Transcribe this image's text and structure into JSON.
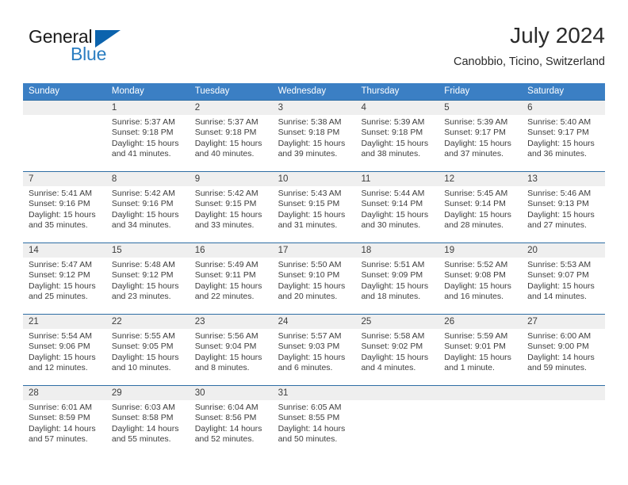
{
  "brand": {
    "name_top": "General",
    "name_bottom": "Blue",
    "accent_color": "#0c63ad",
    "blue_text_color": "#2a7dc1"
  },
  "header": {
    "title": "July 2024",
    "subtitle": "Canobbio, Ticino, Switzerland"
  },
  "theme": {
    "header_row_bg": "#3b7fc4",
    "date_band_bg": "#efefef",
    "row_divider": "#2e6da4",
    "text_color": "#3d3d3d"
  },
  "weekdays": [
    "Sunday",
    "Monday",
    "Tuesday",
    "Wednesday",
    "Thursday",
    "Friday",
    "Saturday"
  ],
  "weeks": [
    {
      "days": [
        {
          "num": "",
          "sunrise": "",
          "sunset": "",
          "daylight_1": "",
          "daylight_2": ""
        },
        {
          "num": "1",
          "sunrise": "Sunrise: 5:37 AM",
          "sunset": "Sunset: 9:18 PM",
          "daylight_1": "Daylight: 15 hours",
          "daylight_2": "and 41 minutes."
        },
        {
          "num": "2",
          "sunrise": "Sunrise: 5:37 AM",
          "sunset": "Sunset: 9:18 PM",
          "daylight_1": "Daylight: 15 hours",
          "daylight_2": "and 40 minutes."
        },
        {
          "num": "3",
          "sunrise": "Sunrise: 5:38 AM",
          "sunset": "Sunset: 9:18 PM",
          "daylight_1": "Daylight: 15 hours",
          "daylight_2": "and 39 minutes."
        },
        {
          "num": "4",
          "sunrise": "Sunrise: 5:39 AM",
          "sunset": "Sunset: 9:18 PM",
          "daylight_1": "Daylight: 15 hours",
          "daylight_2": "and 38 minutes."
        },
        {
          "num": "5",
          "sunrise": "Sunrise: 5:39 AM",
          "sunset": "Sunset: 9:17 PM",
          "daylight_1": "Daylight: 15 hours",
          "daylight_2": "and 37 minutes."
        },
        {
          "num": "6",
          "sunrise": "Sunrise: 5:40 AM",
          "sunset": "Sunset: 9:17 PM",
          "daylight_1": "Daylight: 15 hours",
          "daylight_2": "and 36 minutes."
        }
      ]
    },
    {
      "days": [
        {
          "num": "7",
          "sunrise": "Sunrise: 5:41 AM",
          "sunset": "Sunset: 9:16 PM",
          "daylight_1": "Daylight: 15 hours",
          "daylight_2": "and 35 minutes."
        },
        {
          "num": "8",
          "sunrise": "Sunrise: 5:42 AM",
          "sunset": "Sunset: 9:16 PM",
          "daylight_1": "Daylight: 15 hours",
          "daylight_2": "and 34 minutes."
        },
        {
          "num": "9",
          "sunrise": "Sunrise: 5:42 AM",
          "sunset": "Sunset: 9:15 PM",
          "daylight_1": "Daylight: 15 hours",
          "daylight_2": "and 33 minutes."
        },
        {
          "num": "10",
          "sunrise": "Sunrise: 5:43 AM",
          "sunset": "Sunset: 9:15 PM",
          "daylight_1": "Daylight: 15 hours",
          "daylight_2": "and 31 minutes."
        },
        {
          "num": "11",
          "sunrise": "Sunrise: 5:44 AM",
          "sunset": "Sunset: 9:14 PM",
          "daylight_1": "Daylight: 15 hours",
          "daylight_2": "and 30 minutes."
        },
        {
          "num": "12",
          "sunrise": "Sunrise: 5:45 AM",
          "sunset": "Sunset: 9:14 PM",
          "daylight_1": "Daylight: 15 hours",
          "daylight_2": "and 28 minutes."
        },
        {
          "num": "13",
          "sunrise": "Sunrise: 5:46 AM",
          "sunset": "Sunset: 9:13 PM",
          "daylight_1": "Daylight: 15 hours",
          "daylight_2": "and 27 minutes."
        }
      ]
    },
    {
      "days": [
        {
          "num": "14",
          "sunrise": "Sunrise: 5:47 AM",
          "sunset": "Sunset: 9:12 PM",
          "daylight_1": "Daylight: 15 hours",
          "daylight_2": "and 25 minutes."
        },
        {
          "num": "15",
          "sunrise": "Sunrise: 5:48 AM",
          "sunset": "Sunset: 9:12 PM",
          "daylight_1": "Daylight: 15 hours",
          "daylight_2": "and 23 minutes."
        },
        {
          "num": "16",
          "sunrise": "Sunrise: 5:49 AM",
          "sunset": "Sunset: 9:11 PM",
          "daylight_1": "Daylight: 15 hours",
          "daylight_2": "and 22 minutes."
        },
        {
          "num": "17",
          "sunrise": "Sunrise: 5:50 AM",
          "sunset": "Sunset: 9:10 PM",
          "daylight_1": "Daylight: 15 hours",
          "daylight_2": "and 20 minutes."
        },
        {
          "num": "18",
          "sunrise": "Sunrise: 5:51 AM",
          "sunset": "Sunset: 9:09 PM",
          "daylight_1": "Daylight: 15 hours",
          "daylight_2": "and 18 minutes."
        },
        {
          "num": "19",
          "sunrise": "Sunrise: 5:52 AM",
          "sunset": "Sunset: 9:08 PM",
          "daylight_1": "Daylight: 15 hours",
          "daylight_2": "and 16 minutes."
        },
        {
          "num": "20",
          "sunrise": "Sunrise: 5:53 AM",
          "sunset": "Sunset: 9:07 PM",
          "daylight_1": "Daylight: 15 hours",
          "daylight_2": "and 14 minutes."
        }
      ]
    },
    {
      "days": [
        {
          "num": "21",
          "sunrise": "Sunrise: 5:54 AM",
          "sunset": "Sunset: 9:06 PM",
          "daylight_1": "Daylight: 15 hours",
          "daylight_2": "and 12 minutes."
        },
        {
          "num": "22",
          "sunrise": "Sunrise: 5:55 AM",
          "sunset": "Sunset: 9:05 PM",
          "daylight_1": "Daylight: 15 hours",
          "daylight_2": "and 10 minutes."
        },
        {
          "num": "23",
          "sunrise": "Sunrise: 5:56 AM",
          "sunset": "Sunset: 9:04 PM",
          "daylight_1": "Daylight: 15 hours",
          "daylight_2": "and 8 minutes."
        },
        {
          "num": "24",
          "sunrise": "Sunrise: 5:57 AM",
          "sunset": "Sunset: 9:03 PM",
          "daylight_1": "Daylight: 15 hours",
          "daylight_2": "and 6 minutes."
        },
        {
          "num": "25",
          "sunrise": "Sunrise: 5:58 AM",
          "sunset": "Sunset: 9:02 PM",
          "daylight_1": "Daylight: 15 hours",
          "daylight_2": "and 4 minutes."
        },
        {
          "num": "26",
          "sunrise": "Sunrise: 5:59 AM",
          "sunset": "Sunset: 9:01 PM",
          "daylight_1": "Daylight: 15 hours",
          "daylight_2": "and 1 minute."
        },
        {
          "num": "27",
          "sunrise": "Sunrise: 6:00 AM",
          "sunset": "Sunset: 9:00 PM",
          "daylight_1": "Daylight: 14 hours",
          "daylight_2": "and 59 minutes."
        }
      ]
    },
    {
      "days": [
        {
          "num": "28",
          "sunrise": "Sunrise: 6:01 AM",
          "sunset": "Sunset: 8:59 PM",
          "daylight_1": "Daylight: 14 hours",
          "daylight_2": "and 57 minutes."
        },
        {
          "num": "29",
          "sunrise": "Sunrise: 6:03 AM",
          "sunset": "Sunset: 8:58 PM",
          "daylight_1": "Daylight: 14 hours",
          "daylight_2": "and 55 minutes."
        },
        {
          "num": "30",
          "sunrise": "Sunrise: 6:04 AM",
          "sunset": "Sunset: 8:56 PM",
          "daylight_1": "Daylight: 14 hours",
          "daylight_2": "and 52 minutes."
        },
        {
          "num": "31",
          "sunrise": "Sunrise: 6:05 AM",
          "sunset": "Sunset: 8:55 PM",
          "daylight_1": "Daylight: 14 hours",
          "daylight_2": "and 50 minutes."
        },
        {
          "num": "",
          "sunrise": "",
          "sunset": "",
          "daylight_1": "",
          "daylight_2": ""
        },
        {
          "num": "",
          "sunrise": "",
          "sunset": "",
          "daylight_1": "",
          "daylight_2": ""
        },
        {
          "num": "",
          "sunrise": "",
          "sunset": "",
          "daylight_1": "",
          "daylight_2": ""
        }
      ]
    }
  ]
}
